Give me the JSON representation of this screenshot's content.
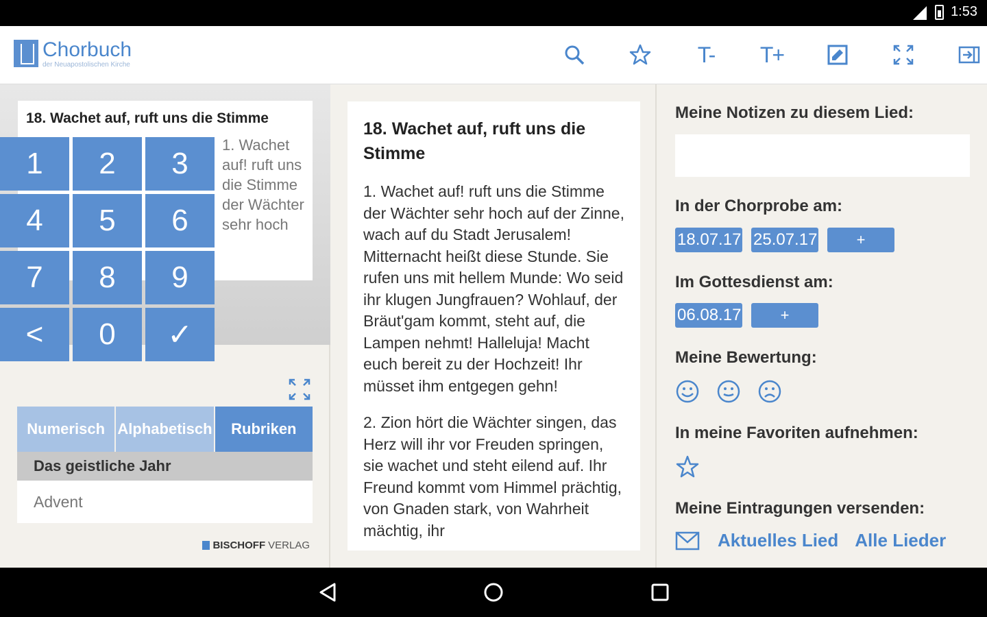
{
  "status_bar": {
    "time": "1:53"
  },
  "app": {
    "title": "Chorbuch",
    "subtitle": "der Neuapostolischen Kirche"
  },
  "toolbar": {
    "font_smaller": "T-",
    "font_larger": "T+"
  },
  "preview": {
    "title": "18. Wachet auf, ruft uns die Stimme",
    "text": "1. Wachet auf! ruft uns die Stimme der Wächter sehr hoch"
  },
  "keypad": {
    "keys": [
      "1",
      "2",
      "3",
      "4",
      "5",
      "6",
      "7",
      "8",
      "9",
      "<",
      "0",
      "✓"
    ]
  },
  "tabs": [
    "Numerisch",
    "Alphabetisch",
    "Rubriken"
  ],
  "category": {
    "header": "Das geistliche Jahr",
    "item": "Advent"
  },
  "publisher": {
    "bold": "BISCHOFF",
    "rest": "VERLAG"
  },
  "song": {
    "title": "18. Wachet auf, ruft uns die Stimme",
    "verses": [
      "1. Wachet auf! ruft uns die Stimme der Wächter sehr hoch auf der Zinne, wach auf du Stadt Jerusalem! Mitternacht heißt diese Stunde. Sie rufen uns mit hellem Munde: Wo seid ihr klugen Jungfrauen? Wohlauf, der Bräut'gam kommt, steht auf, die Lampen nehmt! Halleluja! Macht euch bereit zu der Hochzeit! Ihr müsset ihm entgegen gehn!",
      "2. Zion hört die Wächter singen, das Herz will ihr vor Freuden springen, sie wachet und steht eilend auf. Ihr Freund kommt vom Himmel prächtig, von Gnaden stark, von Wahrheit mächtig, ihr"
    ]
  },
  "notes": {
    "label": "Meine Notizen zu diesem Lied:",
    "value": "",
    "rehearsal_label": "In der Chorprobe am:",
    "rehearsal_dates": [
      "18.07.17",
      "25.07.17"
    ],
    "service_label": "Im Gottesdienst am:",
    "service_dates": [
      "06.08.17"
    ],
    "add_label": "+",
    "rating_label": "Meine Bewertung:",
    "favorites_label": "In meine Favoriten aufnehmen:",
    "send_label": "Meine Eintragungen versenden:",
    "send_current": "Aktuelles Lied",
    "send_all": "Alle Lieder"
  },
  "colors": {
    "accent": "#4a86cc",
    "key": "#5b8fd0",
    "tab_inactive": "#a7c2e4"
  }
}
